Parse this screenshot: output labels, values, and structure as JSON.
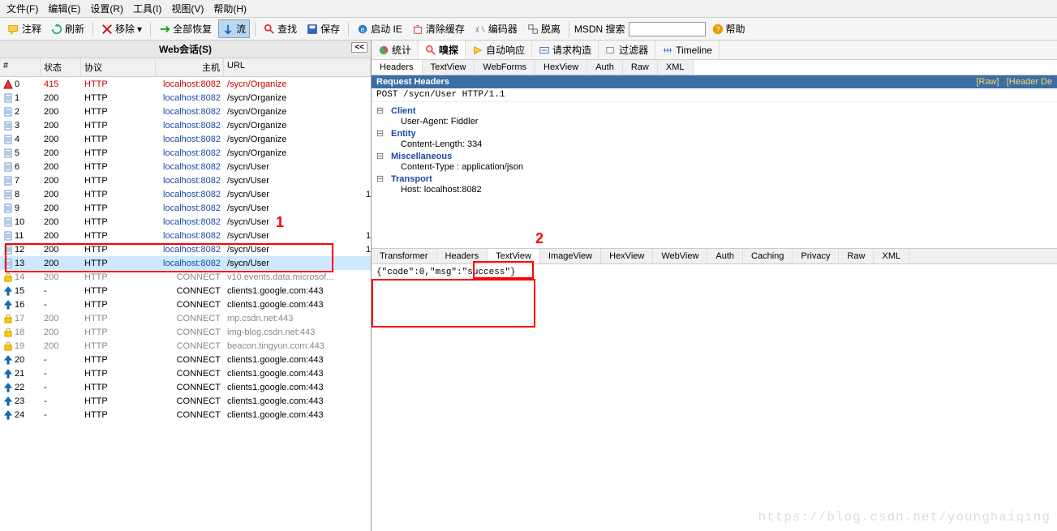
{
  "menu": {
    "file": "文件(F)",
    "edit": "编辑(E)",
    "settings": "设置(R)",
    "tools": "工具(I)",
    "view": "视图(V)",
    "help": "帮助(H)"
  },
  "toolbar": {
    "comment": "注释",
    "refresh": "刷新",
    "remove": "移除",
    "restoreAll": "全部恢复",
    "stream": "流",
    "lookup": "查找",
    "save": "保存",
    "launchIE": "启动 IE",
    "clearCache": "清除缓存",
    "encoder": "编码器",
    "tear": "脱离",
    "msdnLabel": "MSDN 搜索",
    "help": "帮助"
  },
  "sessions": {
    "title": "Web会话(S)",
    "collapse": "<<",
    "columns": {
      "id": "#",
      "status": "状态",
      "proto": "协议",
      "host": "主机",
      "url": "URL"
    },
    "rows": [
      {
        "icon": "warn",
        "id": "0",
        "status": "415",
        "proto": "HTTP",
        "host": "localhost:8082",
        "url": "/sycn/Organize",
        "style": "red"
      },
      {
        "icon": "doc",
        "id": "1",
        "status": "200",
        "proto": "HTTP",
        "host": "localhost:8082",
        "url": "/sycn/Organize",
        "style": "blue"
      },
      {
        "icon": "doc",
        "id": "2",
        "status": "200",
        "proto": "HTTP",
        "host": "localhost:8082",
        "url": "/sycn/Organize",
        "style": "blue"
      },
      {
        "icon": "doc",
        "id": "3",
        "status": "200",
        "proto": "HTTP",
        "host": "localhost:8082",
        "url": "/sycn/Organize",
        "style": "blue"
      },
      {
        "icon": "doc",
        "id": "4",
        "status": "200",
        "proto": "HTTP",
        "host": "localhost:8082",
        "url": "/sycn/Organize",
        "style": "blue"
      },
      {
        "icon": "doc",
        "id": "5",
        "status": "200",
        "proto": "HTTP",
        "host": "localhost:8082",
        "url": "/sycn/Organize",
        "style": "blue"
      },
      {
        "icon": "doc",
        "id": "6",
        "status": "200",
        "proto": "HTTP",
        "host": "localhost:8082",
        "url": "/sycn/User",
        "style": "blue"
      },
      {
        "icon": "doc",
        "id": "7",
        "status": "200",
        "proto": "HTTP",
        "host": "localhost:8082",
        "url": "/sycn/User",
        "style": "blue"
      },
      {
        "icon": "doc",
        "id": "8",
        "status": "200",
        "proto": "HTTP",
        "host": "localhost:8082",
        "url": "/sycn/User",
        "style": "blue",
        "end": "1"
      },
      {
        "icon": "doc",
        "id": "9",
        "status": "200",
        "proto": "HTTP",
        "host": "localhost:8082",
        "url": "/sycn/User",
        "style": "blue"
      },
      {
        "icon": "doc",
        "id": "10",
        "status": "200",
        "proto": "HTTP",
        "host": "localhost:8082",
        "url": "/sycn/User",
        "style": "blue"
      },
      {
        "icon": "doc",
        "id": "11",
        "status": "200",
        "proto": "HTTP",
        "host": "localhost:8082",
        "url": "/sycn/User",
        "style": "blue",
        "end": "1"
      },
      {
        "icon": "doc",
        "id": "12",
        "status": "200",
        "proto": "HTTP",
        "host": "localhost:8082",
        "url": "/sycn/User",
        "style": "blue",
        "end": "1"
      },
      {
        "icon": "doc",
        "id": "13",
        "status": "200",
        "proto": "HTTP",
        "host": "localhost:8082",
        "url": "/sycn/User",
        "style": "blue",
        "selected": true
      },
      {
        "icon": "lock",
        "id": "14",
        "status": "200",
        "proto": "HTTP",
        "host": "CONNECT",
        "url": "v10.events.data.microsof...",
        "style": "gray"
      },
      {
        "icon": "up",
        "id": "15",
        "status": "-",
        "proto": "HTTP",
        "host": "CONNECT",
        "url": "clients1.google.com:443"
      },
      {
        "icon": "up",
        "id": "16",
        "status": "-",
        "proto": "HTTP",
        "host": "CONNECT",
        "url": "clients1.google.com:443"
      },
      {
        "icon": "lock",
        "id": "17",
        "status": "200",
        "proto": "HTTP",
        "host": "CONNECT",
        "url": "mp.csdn.net:443",
        "style": "gray"
      },
      {
        "icon": "lock",
        "id": "18",
        "status": "200",
        "proto": "HTTP",
        "host": "CONNECT",
        "url": "img-blog.csdn.net:443",
        "style": "gray"
      },
      {
        "icon": "lock",
        "id": "19",
        "status": "200",
        "proto": "HTTP",
        "host": "CONNECT",
        "url": "beacon.tingyun.com:443",
        "style": "gray"
      },
      {
        "icon": "up",
        "id": "20",
        "status": "-",
        "proto": "HTTP",
        "host": "CONNECT",
        "url": "clients1.google.com:443"
      },
      {
        "icon": "up",
        "id": "21",
        "status": "-",
        "proto": "HTTP",
        "host": "CONNECT",
        "url": "clients1.google.com:443"
      },
      {
        "icon": "up",
        "id": "22",
        "status": "-",
        "proto": "HTTP",
        "host": "CONNECT",
        "url": "clients1.google.com:443"
      },
      {
        "icon": "up",
        "id": "23",
        "status": "-",
        "proto": "HTTP",
        "host": "CONNECT",
        "url": "clients1.google.com:443"
      },
      {
        "icon": "up",
        "id": "24",
        "status": "-",
        "proto": "HTTP",
        "host": "CONNECT",
        "url": "clients1.google.com:443"
      }
    ]
  },
  "inspector": {
    "tabs": {
      "stats": "统计",
      "inspect": "嗅探",
      "autoresponder": "自动响应",
      "composer": "请求构造",
      "filters": "过滤器",
      "timeline": "Timeline"
    },
    "subTabs": {
      "headers": "Headers",
      "textview": "TextView",
      "webforms": "WebForms",
      "hexview": "HexView",
      "auth": "Auth",
      "raw": "Raw",
      "xml": "XML"
    },
    "requestBar": {
      "title": "Request Headers",
      "raw": "[Raw]",
      "headerDef": "[Header De"
    },
    "requestLine": "POST /sycn/User HTTP/1.1",
    "tree": {
      "client": {
        "label": "Client",
        "userAgent": "User-Agent: Fiddler"
      },
      "entity": {
        "label": "Entity",
        "contentLength": "Content-Length: 334"
      },
      "misc": {
        "label": "Miscellaneous",
        "contentType": "Content-Type : application/json"
      },
      "transport": {
        "label": "Transport",
        "host": "Host: localhost:8082"
      }
    },
    "respTabs": {
      "transformer": "Transformer",
      "headers": "Headers",
      "textview": "TextView",
      "imageview": "ImageView",
      "hexview": "HexView",
      "webview": "WebView",
      "auth": "Auth",
      "caching": "Caching",
      "privacy": "Privacy",
      "raw": "Raw",
      "xml": "XML"
    },
    "responseBody": "{\"code\":0,\"msg\":\"success\"}"
  },
  "annotations": {
    "one": "1",
    "two": "2"
  },
  "watermark": "https://blog.csdn.net/younghaiqing"
}
